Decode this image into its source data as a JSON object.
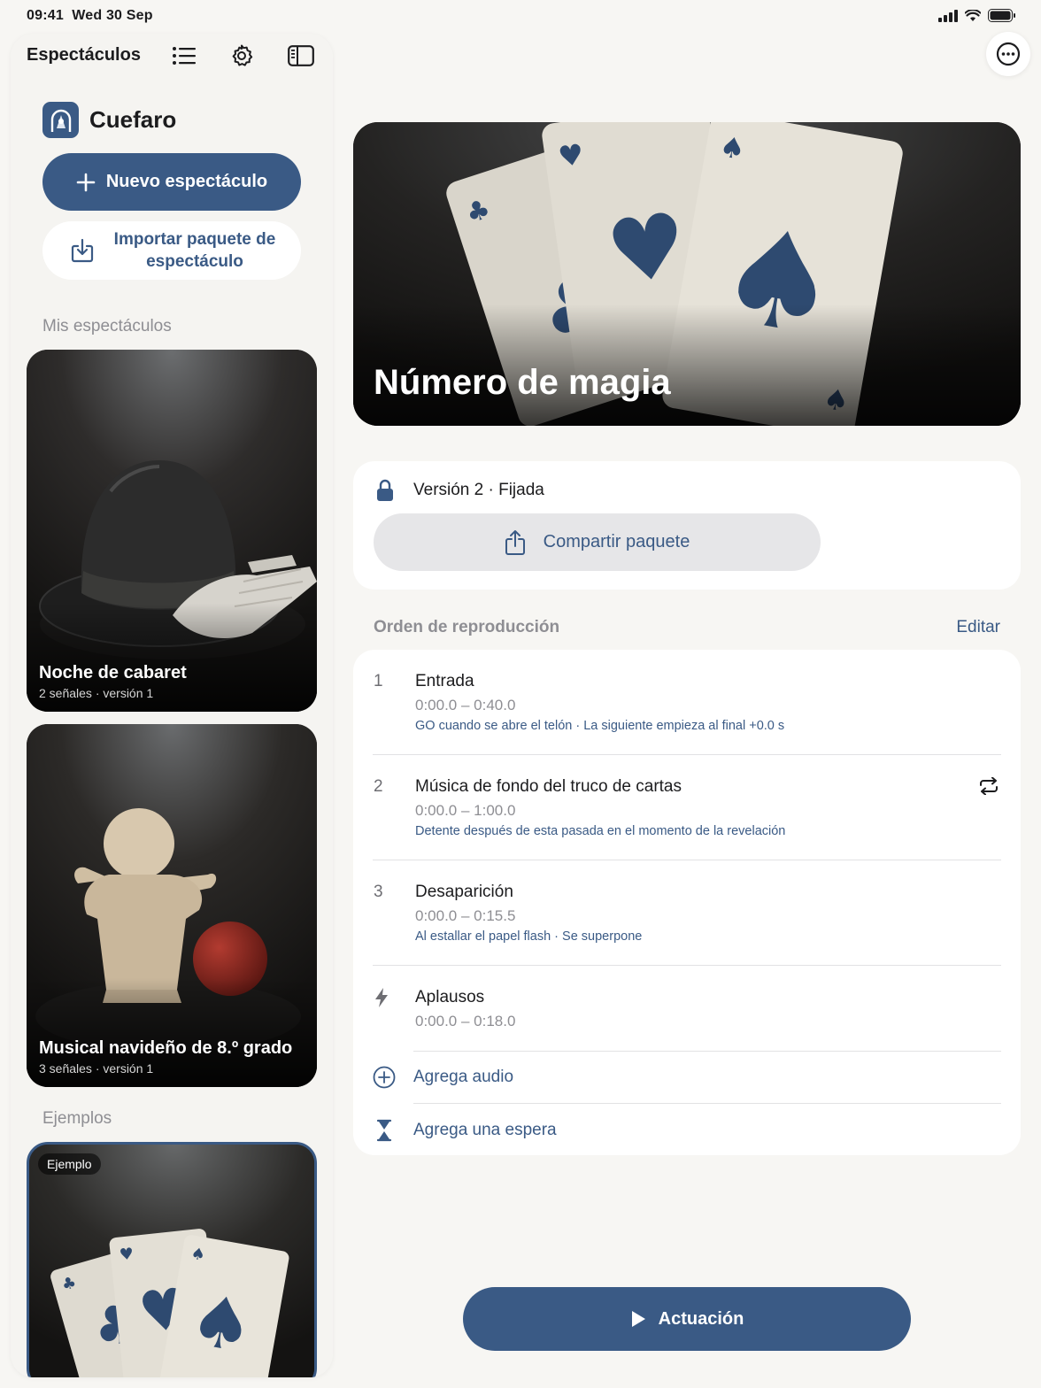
{
  "status_bar": {
    "time": "09:41",
    "date": "Wed 30 Sep"
  },
  "sidebar": {
    "title": "Espectáculos",
    "tools": [
      "list-icon",
      "gear-icon",
      "sidebar-icon"
    ],
    "brand": "Cuefaro",
    "new_show_label": "Nuevo espectáculo",
    "import_label": "Importar paquete de espectáculo",
    "my_shows_heading": "Mis espectáculos",
    "shows": [
      {
        "title": "Noche de cabaret",
        "subtitle": "2 señales · versión 1"
      },
      {
        "title": "Musical navideño de 8.º grado",
        "subtitle": "3 señales · versión 1"
      }
    ],
    "examples_heading": "Ejemplos",
    "example_badge": "Ejemplo"
  },
  "main": {
    "title": "Número de magia",
    "version": "Versión 2 · Fijada",
    "share_label": "Compartir paquete",
    "playback_heading": "Orden de reproducción",
    "edit_label": "Editar",
    "cues": [
      {
        "number": "1",
        "title": "Entrada",
        "time": "0:00.0 – 0:40.0",
        "note": "GO cuando se abre el telón · La siguiente empieza al final +0.0 s"
      },
      {
        "number": "2",
        "title": "Música de fondo del truco de cartas",
        "time": "0:00.0 – 1:00.0",
        "note": "Detente después de esta pasada en el momento de la revelación",
        "loop": true
      },
      {
        "number": "3",
        "title": "Desaparición",
        "time": "0:00.0 – 0:15.5",
        "note": "Al estallar el papel flash · Se superpone"
      },
      {
        "number": "",
        "title": "Aplausos",
        "time": "0:00.0 – 0:18.0",
        "note": "",
        "icon": "bolt-icon"
      }
    ],
    "add_audio_label": "Agrega audio",
    "add_wait_label": "Agrega una espera",
    "perform_label": "Actuación"
  },
  "colors": {
    "accent": "#3a5a85",
    "background": "#f7f6f3",
    "card": "#ffffff"
  }
}
